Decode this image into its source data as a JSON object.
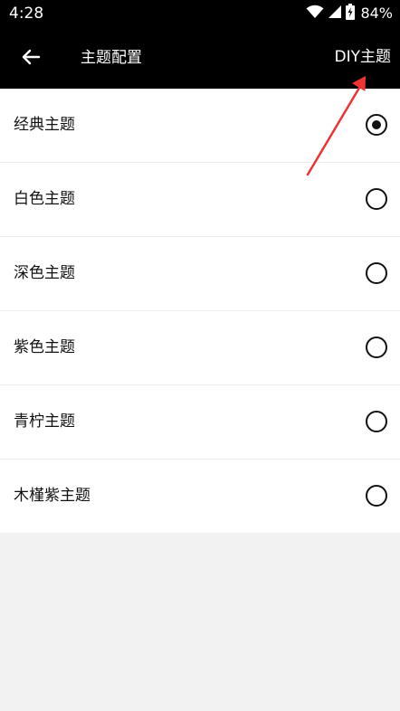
{
  "status_bar": {
    "time": "4:28",
    "battery": "84%",
    "icons": [
      "wifi-icon",
      "signal-icon",
      "battery-charging-icon"
    ]
  },
  "toolbar": {
    "title": "主题配置",
    "diy_label": "DIY主题",
    "back_icon": "back-arrow-icon"
  },
  "themes": [
    {
      "label": "经典主题",
      "selected": true
    },
    {
      "label": "白色主题",
      "selected": false
    },
    {
      "label": "深色主题",
      "selected": false
    },
    {
      "label": "紫色主题",
      "selected": false
    },
    {
      "label": "青柠主题",
      "selected": false
    },
    {
      "label": "木槿紫主题",
      "selected": false
    }
  ],
  "colors": {
    "bar_background": "#000000",
    "list_background": "#ffffff",
    "page_background": "#f2f2f2",
    "annotation_arrow": "#ee3333"
  }
}
